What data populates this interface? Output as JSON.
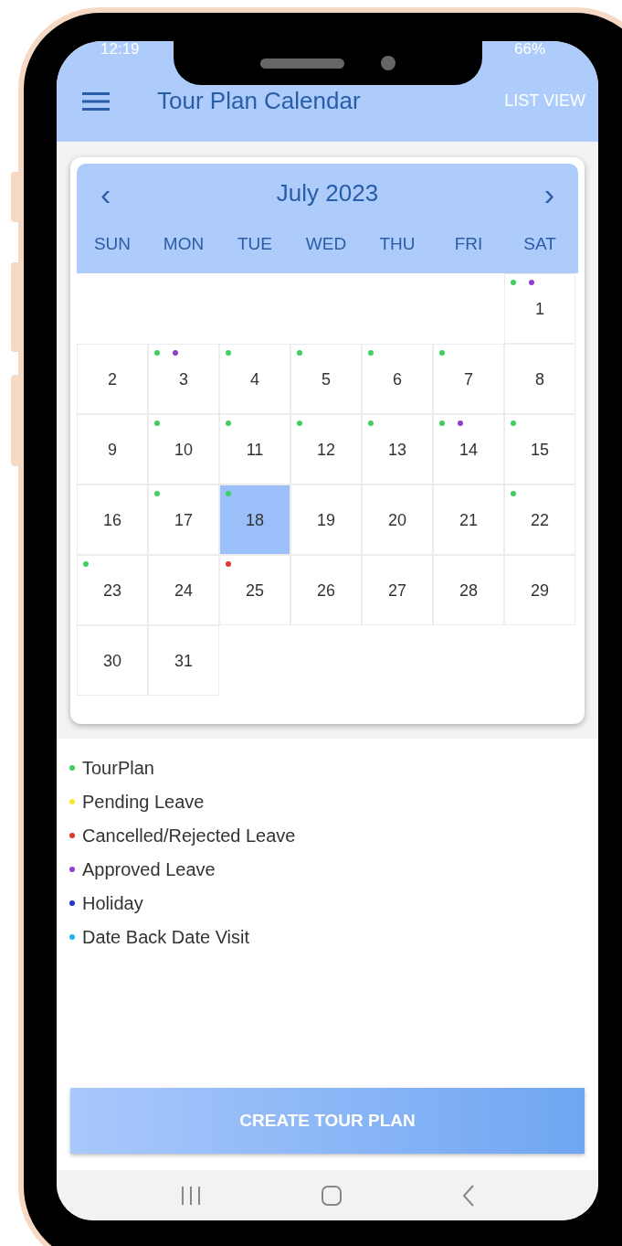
{
  "status_bar": {
    "time": "12:19",
    "battery": "66%"
  },
  "app_bar": {
    "title": "Tour Plan Calendar",
    "action": "LIST VIEW"
  },
  "calendar": {
    "month": "July 2023",
    "prev": "‹",
    "next": "›",
    "weekdays": [
      "SUN",
      "MON",
      "TUE",
      "WED",
      "THU",
      "FRI",
      "SAT"
    ],
    "weeks": [
      [
        {
          "kind": "blank"
        },
        {
          "kind": "blank"
        },
        {
          "kind": "blank"
        },
        {
          "kind": "blank"
        },
        {
          "kind": "blank"
        },
        {
          "kind": "blank"
        },
        {
          "kind": "day",
          "day": "1",
          "selected": false,
          "dots": [
            {
              "color": "#3fcf5a"
            },
            {
              "color": "#8e3fd0"
            }
          ]
        }
      ],
      [
        {
          "kind": "day",
          "day": "2",
          "selected": false
        },
        {
          "kind": "day",
          "day": "3",
          "selected": false,
          "dots": [
            {
              "color": "#3fcf5a"
            },
            {
              "color": "#8e3fd0"
            }
          ]
        },
        {
          "kind": "day",
          "day": "4",
          "selected": false,
          "dots": [
            {
              "color": "#3fcf5a"
            }
          ]
        },
        {
          "kind": "day",
          "day": "5",
          "selected": false,
          "dots": [
            {
              "color": "#3fcf5a"
            }
          ]
        },
        {
          "kind": "day",
          "day": "6",
          "selected": false,
          "dots": [
            {
              "color": "#3fcf5a"
            }
          ]
        },
        {
          "kind": "day",
          "day": "7",
          "selected": false,
          "dots": [
            {
              "color": "#3fcf5a"
            }
          ]
        },
        {
          "kind": "day",
          "day": "8",
          "selected": false
        }
      ],
      [
        {
          "kind": "day",
          "day": "9",
          "selected": false
        },
        {
          "kind": "day",
          "day": "10",
          "selected": false,
          "dots": [
            {
              "color": "#3fcf5a"
            }
          ]
        },
        {
          "kind": "day",
          "day": "11",
          "selected": false,
          "dots": [
            {
              "color": "#3fcf5a"
            }
          ]
        },
        {
          "kind": "day",
          "day": "12",
          "selected": false,
          "dots": [
            {
              "color": "#3fcf5a"
            }
          ]
        },
        {
          "kind": "day",
          "day": "13",
          "selected": false,
          "dots": [
            {
              "color": "#3fcf5a"
            }
          ]
        },
        {
          "kind": "day",
          "day": "14",
          "selected": false,
          "dots": [
            {
              "color": "#3fcf5a"
            },
            {
              "color": "#8e3fd0"
            }
          ]
        },
        {
          "kind": "day",
          "day": "15",
          "selected": false,
          "dots": [
            {
              "color": "#3fcf5a"
            }
          ]
        }
      ],
      [
        {
          "kind": "day",
          "day": "16",
          "selected": false
        },
        {
          "kind": "day",
          "day": "17",
          "selected": false,
          "dots": [
            {
              "color": "#3fcf5a"
            }
          ]
        },
        {
          "kind": "day",
          "day": "18",
          "selected": true,
          "dots": [
            {
              "color": "#3fcf5a"
            }
          ]
        },
        {
          "kind": "day",
          "day": "19",
          "selected": false
        },
        {
          "kind": "day",
          "day": "20",
          "selected": false
        },
        {
          "kind": "day",
          "day": "21",
          "selected": false
        },
        {
          "kind": "day",
          "day": "22",
          "selected": false,
          "dots": [
            {
              "color": "#3fcf5a"
            }
          ]
        }
      ],
      [
        {
          "kind": "day",
          "day": "23",
          "selected": false,
          "dots": [
            {
              "color": "#3fcf5a"
            }
          ]
        },
        {
          "kind": "day",
          "day": "24",
          "selected": false
        },
        {
          "kind": "day",
          "day": "25",
          "selected": false,
          "dots": [
            {
              "color": "#e0392b"
            }
          ]
        },
        {
          "kind": "day",
          "day": "26",
          "selected": false
        },
        {
          "kind": "day",
          "day": "27",
          "selected": false
        },
        {
          "kind": "day",
          "day": "28",
          "selected": false
        },
        {
          "kind": "day",
          "day": "29",
          "selected": false
        }
      ],
      [
        {
          "kind": "day",
          "day": "30",
          "selected": false
        },
        {
          "kind": "day",
          "day": "31",
          "selected": false
        }
      ]
    ]
  },
  "legend": [
    {
      "label": "TourPlan",
      "color": "#3fcf5a"
    },
    {
      "label": "Pending Leave",
      "color": "#f5e82a"
    },
    {
      "label": "Cancelled/Rejected Leave",
      "color": "#e0392b"
    },
    {
      "label": "Approved Leave",
      "color": "#8e3fd0"
    },
    {
      "label": "Holiday",
      "color": "#2631d6"
    },
    {
      "label": "Date Back Date Visit",
      "color": "#22b0f0"
    }
  ],
  "primary_button": {
    "label": "CREATE TOUR PLAN"
  }
}
